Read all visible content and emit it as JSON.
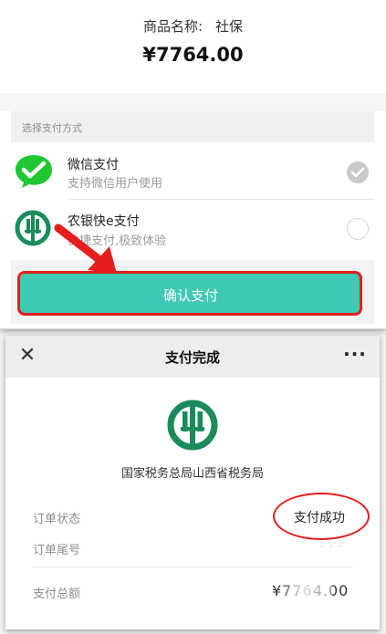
{
  "top": {
    "product_label": "商品名称:",
    "product_name": "社保",
    "amount": "¥7764.00",
    "method_header": "选择支付方式",
    "methods": [
      {
        "title": "微信支付",
        "subtitle": "支持微信用户使用",
        "icon": "wechat-pay-icon",
        "selected": true
      },
      {
        "title": "农银快e支付",
        "subtitle": "快捷支付,极致体验",
        "icon": "abc-bank-icon",
        "selected": false
      }
    ],
    "confirm_label": "确认支付",
    "accent": "#40c9b3",
    "highlight": "#e41e1e"
  },
  "bottom": {
    "nav_title": "支付完成",
    "close_glyph": "✕",
    "more_glyph": "···",
    "merchant": "国家税务总局山西省税务局",
    "rows": {
      "status_label": "订单状态",
      "status_value": "支付成功",
      "order_label": "订单尾号",
      "order_value": "· · ·",
      "total_label": "支付总额",
      "total_value": "¥7764.00"
    },
    "logo_color": "#1a8b5a"
  }
}
